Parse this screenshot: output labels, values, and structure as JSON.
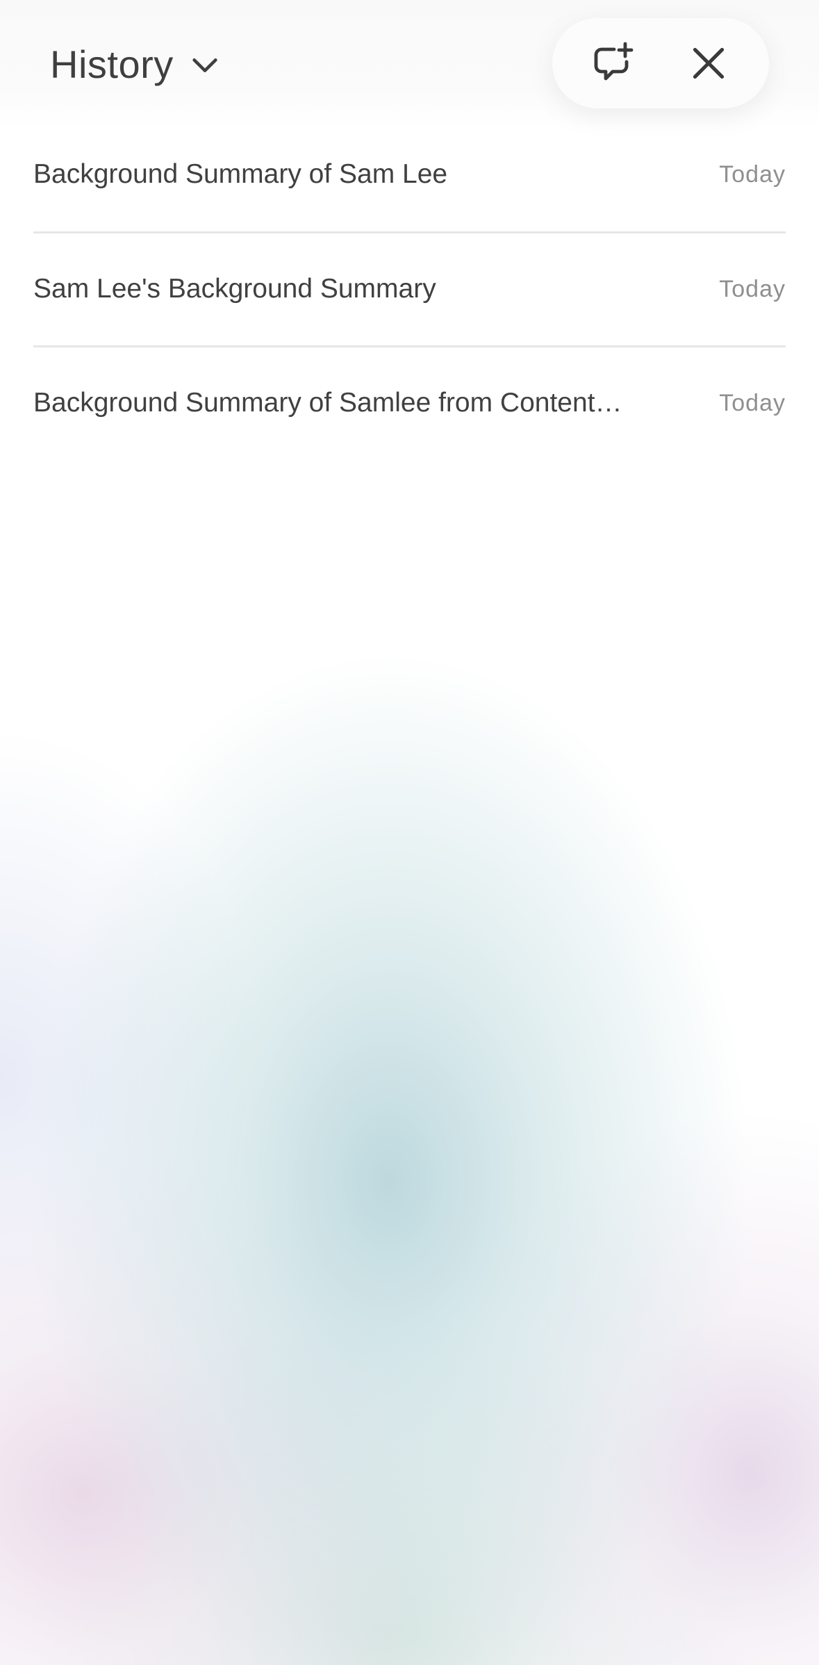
{
  "header": {
    "title": "History",
    "dropdown_icon": "chevron-down-icon",
    "new_chat_icon": "chat-plus-icon",
    "close_icon": "close-icon"
  },
  "history": {
    "items": [
      {
        "title": "Background Summary of Sam Lee",
        "date": "Today"
      },
      {
        "title": "Sam Lee's Background Summary",
        "date": "Today"
      },
      {
        "title": "Background Summary of Samlee from Content…",
        "date": "Today"
      }
    ]
  },
  "colors": {
    "text_primary": "#404040",
    "text_secondary": "#8f8f8f",
    "divider": "#e6e6e6",
    "gradient_teal": "#b2d2d8",
    "gradient_pink": "#e8d6e6"
  }
}
